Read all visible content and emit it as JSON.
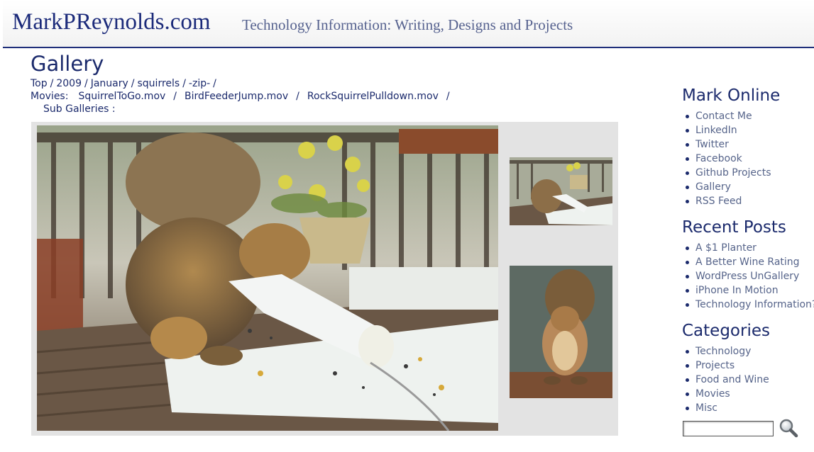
{
  "header": {
    "site_title": "MarkPReynolds.com",
    "tagline": "Technology Information:  Writing, Designs and Projects"
  },
  "page": {
    "title": "Gallery",
    "breadcrumb": [
      "Top",
      "2009",
      "January",
      "squirrels",
      "-zip-"
    ],
    "breadcrumb_sep": "/",
    "movies_label": "Movies:",
    "movies": [
      "SquirrelToGo.mov",
      "BirdFeederJump.mov",
      "RockSquirrelPulldown.mov"
    ],
    "sub_galleries_label": "Sub Galleries :"
  },
  "sidebar": {
    "mark_online": {
      "heading": "Mark Online",
      "items": [
        "Contact Me",
        "LinkedIn",
        "Twitter",
        "Facebook",
        "Github Projects",
        "Gallery",
        "RSS Feed"
      ]
    },
    "recent_posts": {
      "heading": "Recent Posts",
      "items": [
        "A $1 Planter",
        "A Better Wine Rating",
        "WordPress UnGallery",
        "iPhone In Motion",
        "Technology Information?"
      ]
    },
    "categories": {
      "heading": "Categories",
      "items": [
        "Technology",
        "Projects",
        "Food and Wine",
        "Movies",
        "Misc"
      ]
    }
  },
  "search": {
    "value": "",
    "icon": "magnifier-icon"
  },
  "colors": {
    "brand": "#1b2a7a",
    "link": "#1b2a6c",
    "sidebar_link": "#56648a",
    "frame": "#e3e3e3"
  }
}
